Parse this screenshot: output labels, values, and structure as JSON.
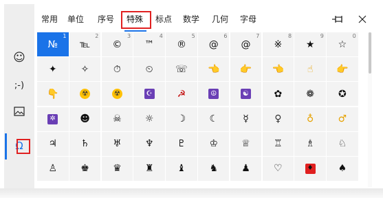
{
  "rail": {
    "items": [
      {
        "name": "emoji-icon",
        "glyph": "☺"
      },
      {
        "name": "kaomoji-icon",
        "glyph": ";-)"
      },
      {
        "name": "gif-icon",
        "glyph": "🖼"
      },
      {
        "name": "symbols-icon",
        "glyph": "Ω"
      }
    ]
  },
  "tabs": [
    {
      "label": "常用"
    },
    {
      "label": "单位"
    },
    {
      "label": "序号"
    },
    {
      "label": "特殊"
    },
    {
      "label": "标点"
    },
    {
      "label": "数学"
    },
    {
      "label": "几何"
    },
    {
      "label": "字母"
    }
  ],
  "icons": {
    "pin": "pin-icon",
    "close": "close-icon"
  },
  "grid": {
    "rows": [
      [
        {
          "g": "№",
          "n": "1"
        },
        {
          "g": "℡",
          "n": "2"
        },
        {
          "g": "©",
          "n": "3"
        },
        {
          "g": "™",
          "n": "4"
        },
        {
          "g": "®",
          "n": "5"
        },
        {
          "g": "@",
          "n": "6"
        },
        {
          "g": "@",
          "n": "7"
        },
        {
          "g": "※",
          "n": "8"
        },
        {
          "g": "★",
          "n": "9"
        },
        {
          "g": "☆",
          "n": "0"
        }
      ],
      [
        {
          "g": "✦"
        },
        {
          "g": "✧"
        },
        {
          "g": "⏱"
        },
        {
          "g": "⏲"
        },
        {
          "g": "☏"
        },
        {
          "g": "👈"
        },
        {
          "g": "👉"
        },
        {
          "g": "👈"
        },
        {
          "g": "☝"
        },
        {
          "g": "👉"
        }
      ],
      [
        {
          "g": "👇"
        },
        {
          "g": "☢"
        },
        {
          "g": "☢"
        },
        {
          "g": "☪"
        },
        {
          "g": "☭"
        },
        {
          "g": "☮"
        },
        {
          "g": "☯"
        },
        {
          "g": "✿"
        },
        {
          "g": "❁"
        },
        {
          "g": "✪"
        }
      ],
      [
        {
          "g": "✲"
        },
        {
          "g": "☻"
        },
        {
          "g": "☠"
        },
        {
          "g": "☼"
        },
        {
          "g": "☽"
        },
        {
          "g": "☾"
        },
        {
          "g": "☿"
        },
        {
          "g": "♀"
        },
        {
          "g": "♁"
        },
        {
          "g": "♂"
        }
      ],
      [
        {
          "g": "♃"
        },
        {
          "g": "♄"
        },
        {
          "g": "♅"
        },
        {
          "g": "♆"
        },
        {
          "g": "♇"
        },
        {
          "g": "♔"
        },
        {
          "g": "♕"
        },
        {
          "g": "♖"
        },
        {
          "g": "♗"
        },
        {
          "g": "♘"
        }
      ],
      [
        {
          "g": "♙"
        },
        {
          "g": "♚"
        },
        {
          "g": "♛"
        },
        {
          "g": "♜"
        },
        {
          "g": "♝"
        },
        {
          "g": "♞"
        },
        {
          "g": "♟"
        },
        {
          "g": "♡"
        },
        {
          "g": "♦"
        },
        {
          "g": "♠"
        }
      ]
    ]
  },
  "colors": {
    "accent": "#1a73e8",
    "highlight": "#e02020",
    "tile": "#f3f3f3"
  }
}
